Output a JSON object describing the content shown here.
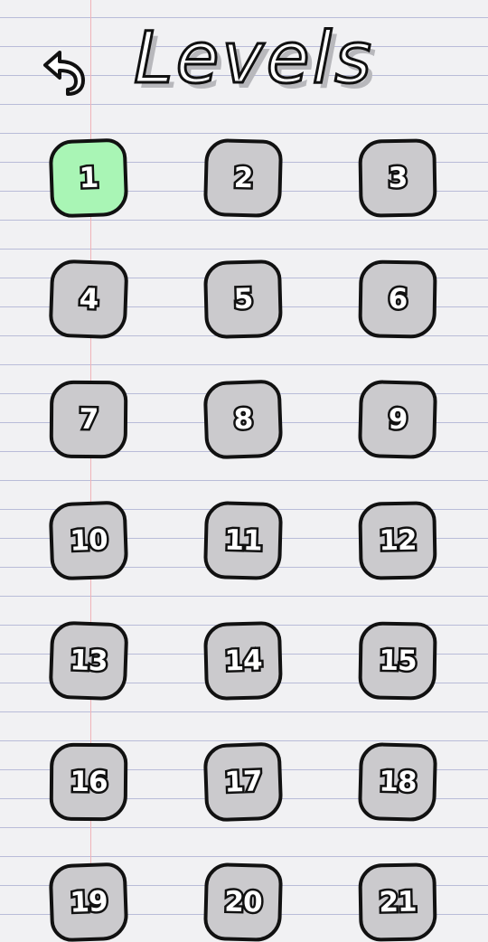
{
  "header": {
    "title": "Levels",
    "back_icon": "back-arrow-icon"
  },
  "colors": {
    "paper": "#f1f1f3",
    "rule_line": "#b9bcd8",
    "margin_line": "#f0b3b8",
    "locked_level": "#cbcacd",
    "unlocked_level": "#a9f5b5",
    "outline": "#111111"
  },
  "levels": [
    {
      "label": "1",
      "unlocked": true
    },
    {
      "label": "2",
      "unlocked": false
    },
    {
      "label": "3",
      "unlocked": false
    },
    {
      "label": "4",
      "unlocked": false
    },
    {
      "label": "5",
      "unlocked": false
    },
    {
      "label": "6",
      "unlocked": false
    },
    {
      "label": "7",
      "unlocked": false
    },
    {
      "label": "8",
      "unlocked": false
    },
    {
      "label": "9",
      "unlocked": false
    },
    {
      "label": "10",
      "unlocked": false
    },
    {
      "label": "11",
      "unlocked": false
    },
    {
      "label": "12",
      "unlocked": false
    },
    {
      "label": "13",
      "unlocked": false
    },
    {
      "label": "14",
      "unlocked": false
    },
    {
      "label": "15",
      "unlocked": false
    },
    {
      "label": "16",
      "unlocked": false
    },
    {
      "label": "17",
      "unlocked": false
    },
    {
      "label": "18",
      "unlocked": false
    },
    {
      "label": "19",
      "unlocked": false
    },
    {
      "label": "20",
      "unlocked": false
    },
    {
      "label": "21",
      "unlocked": false
    }
  ]
}
